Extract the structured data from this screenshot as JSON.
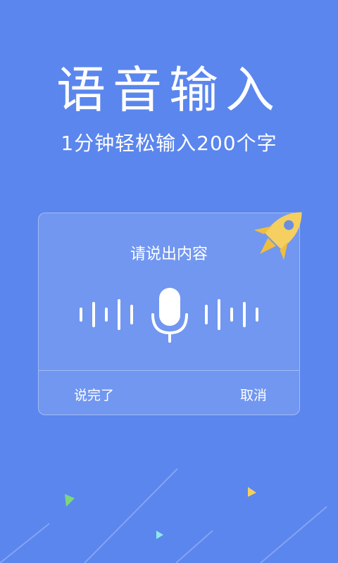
{
  "hero": {
    "title": "语音输入",
    "subtitle": "1分钟轻松输入200个字"
  },
  "dialog": {
    "prompt": "请说出内容",
    "done_label": "说完了",
    "cancel_label": "取消"
  },
  "icons": {
    "mic": "microphone-icon",
    "rocket": "rocket-icon"
  },
  "colors": {
    "background": "#5b86ee",
    "rocket": "#f5cf5f"
  }
}
